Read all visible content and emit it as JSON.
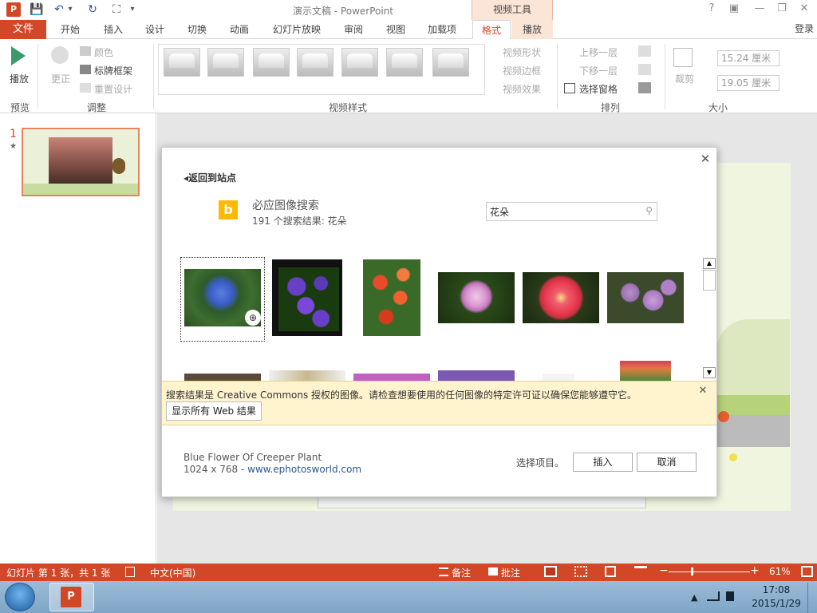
{
  "window": {
    "title": "演示文稿 - PowerPoint",
    "context_tab_header": "视频工具",
    "help": "?",
    "ribbon_display": "▣",
    "minimize": "—",
    "restore": "❐",
    "close": "✕"
  },
  "qat": {
    "app_icon": "P",
    "save": "💾",
    "undo": "↶",
    "undo_more": "▾",
    "redo": "↻",
    "from_start": "⛶",
    "customize": "▾"
  },
  "tabs": {
    "file": "文件",
    "items": [
      "开始",
      "插入",
      "设计",
      "切换",
      "动画",
      "幻灯片放映",
      "审阅",
      "视图",
      "加载项"
    ],
    "format": "格式",
    "playback": "播放",
    "signin": "登录"
  },
  "ribbon": {
    "preview": {
      "play": "播放",
      "group": "预览"
    },
    "adjust": {
      "corrections": "更正",
      "color": "颜色",
      "poster_frame": "标牌框架",
      "reset_design": "重置设计",
      "group": "调整"
    },
    "video_styles": {
      "shape": "视频形状",
      "border": "视频边框",
      "effects": "视频效果",
      "group": "视频样式"
    },
    "arrange": {
      "bring_forward": "上移一层",
      "send_backward": "下移一层",
      "selection_pane": "选择窗格",
      "group": "排列"
    },
    "size": {
      "crop": "裁剪",
      "height": "15.24 厘米",
      "width": "19.05 厘米",
      "group": "大小"
    }
  },
  "slide_panel": {
    "number": "1",
    "star": "★"
  },
  "dialog": {
    "close": "✕",
    "back": "返回到站点",
    "back_arrow": "◂",
    "provider_logo": "b",
    "title": "必应图像搜索",
    "result_count": "191 个搜索结果: 花朵",
    "search_value": "花朵",
    "scroll_up": "▲",
    "scroll_down": "▼",
    "zoom": "⊕",
    "notice": "搜索结果是 Creative Commons 授权的图像。请检查想要使用的任何图像的特定许可证以确保您能够遵守它。",
    "show_all_web": "显示所有 Web 结果",
    "selected_title": "Blue Flower Of Creeper Plant",
    "selected_dims": "1024 x 768 - ",
    "selected_source": "www.ephotosworld.com",
    "select_hint": "选择项目。",
    "insert": "插入",
    "cancel": "取消"
  },
  "statusbar": {
    "slide_info": "幻灯片 第 1 张，共 1 张",
    "language": "中文(中国)",
    "notes": "备注",
    "comments": "批注",
    "zoom_minus": "−",
    "zoom_plus": "+",
    "zoom": "61%",
    "zoom_level": 0.61
  },
  "taskbar": {
    "app_icon": "P",
    "time": "17:08",
    "date": "2015/1/29"
  },
  "colors": {
    "accent": "#d24726",
    "notice_bg": "#fff4ce",
    "context_tab": "#fbe5d6"
  }
}
